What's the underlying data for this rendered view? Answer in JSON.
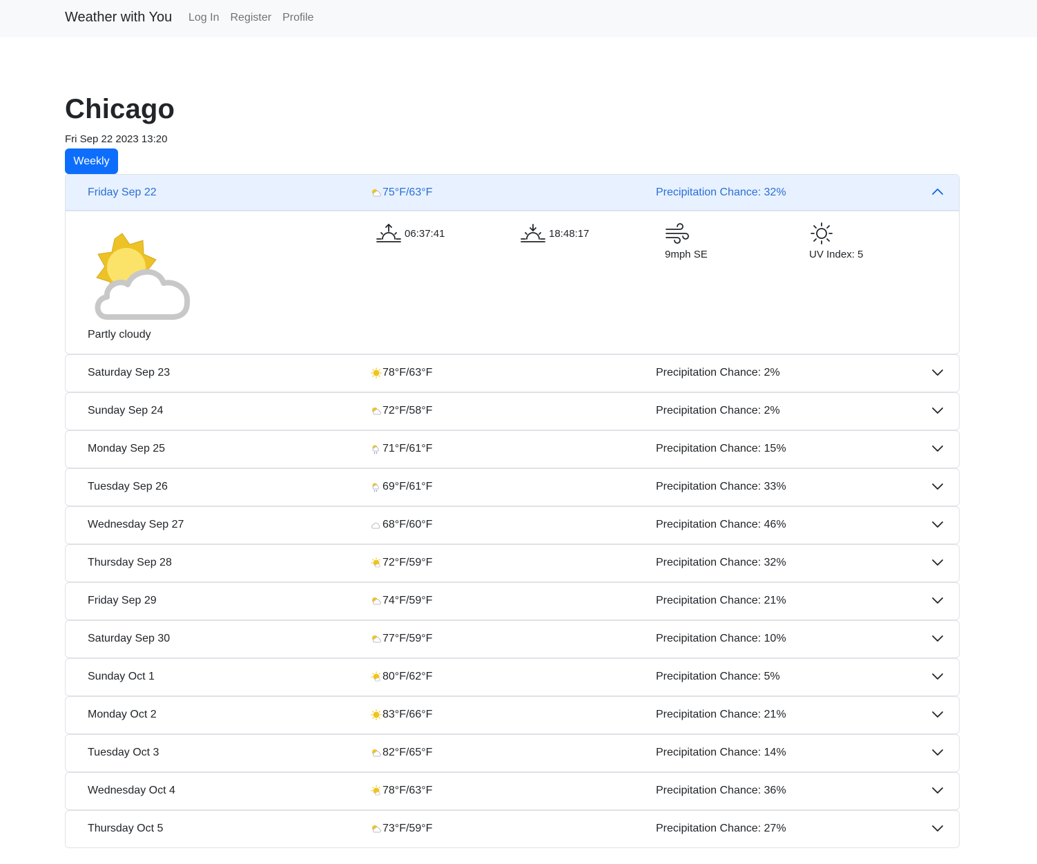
{
  "nav": {
    "brand": "Weather with You",
    "links": [
      "Log In",
      "Register",
      "Profile"
    ]
  },
  "header": {
    "city": "Chicago",
    "datetime": "Fri Sep 22 2023 13:20",
    "weekly_button": "Weekly"
  },
  "today": {
    "day": "Friday Sep 22",
    "temp": "75°F/63°F",
    "precip": "Precipitation Chance: 32%",
    "icon": "partly-cloudy-icon",
    "condition": "Partly cloudy",
    "sunrise": "06:37:41",
    "sunset": "18:48:17",
    "wind": "9mph SE",
    "uv": "UV Index: 5"
  },
  "days": [
    {
      "day": "Saturday Sep 23",
      "temp": "78°F/63°F",
      "precip": "Precipitation Chance: 2%",
      "icon": "sunny"
    },
    {
      "day": "Sunday Sep 24",
      "temp": "72°F/58°F",
      "precip": "Precipitation Chance: 2%",
      "icon": "partly-cloudy"
    },
    {
      "day": "Monday Sep 25",
      "temp": "71°F/61°F",
      "precip": "Precipitation Chance: 15%",
      "icon": "light-rain"
    },
    {
      "day": "Tuesday Sep 26",
      "temp": "69°F/61°F",
      "precip": "Precipitation Chance: 33%",
      "icon": "light-rain"
    },
    {
      "day": "Wednesday Sep 27",
      "temp": "68°F/60°F",
      "precip": "Precipitation Chance: 46%",
      "icon": "cloudy"
    },
    {
      "day": "Thursday Sep 28",
      "temp": "72°F/59°F",
      "precip": "Precipitation Chance: 32%",
      "icon": "mostly-sunny"
    },
    {
      "day": "Friday Sep 29",
      "temp": "74°F/59°F",
      "precip": "Precipitation Chance: 21%",
      "icon": "partly-cloudy"
    },
    {
      "day": "Saturday Sep 30",
      "temp": "77°F/59°F",
      "precip": "Precipitation Chance: 10%",
      "icon": "partly-cloudy"
    },
    {
      "day": "Sunday Oct 1",
      "temp": "80°F/62°F",
      "precip": "Precipitation Chance: 5%",
      "icon": "mostly-sunny"
    },
    {
      "day": "Monday Oct 2",
      "temp": "83°F/66°F",
      "precip": "Precipitation Chance: 21%",
      "icon": "sunny"
    },
    {
      "day": "Tuesday Oct 3",
      "temp": "82°F/65°F",
      "precip": "Precipitation Chance: 14%",
      "icon": "partly-cloudy"
    },
    {
      "day": "Wednesday Oct 4",
      "temp": "78°F/63°F",
      "precip": "Precipitation Chance: 36%",
      "icon": "mostly-sunny"
    },
    {
      "day": "Thursday Oct 5",
      "temp": "73°F/59°F",
      "precip": "Precipitation Chance: 27%",
      "icon": "partly-cloudy"
    }
  ],
  "colors": {
    "primary": "#0d6efd",
    "open_header_bg": "#e7f1ff",
    "open_header_text": "#0c63e4",
    "sun": "#f0c419",
    "cloud": "#c8c8c8"
  }
}
